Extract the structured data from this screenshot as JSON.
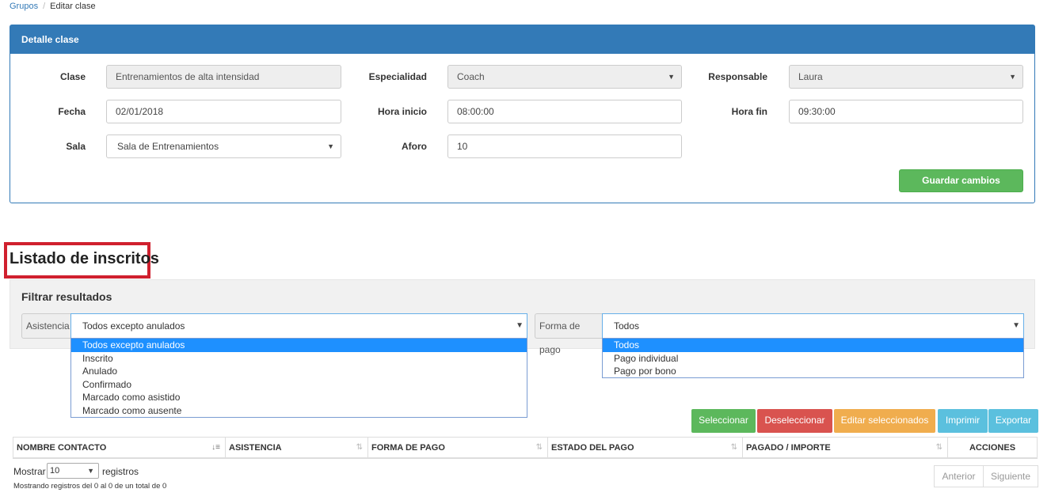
{
  "breadcrumb": {
    "link": "Grupos",
    "separator": "/",
    "current": "Editar clase"
  },
  "panel": {
    "heading": "Detalle clase",
    "clase": {
      "label": "Clase",
      "value": "Entrenamientos de alta intensidad"
    },
    "especialidad": {
      "label": "Especialidad",
      "value": "Coach"
    },
    "responsable": {
      "label": "Responsable",
      "value": "Laura"
    },
    "fecha": {
      "label": "Fecha",
      "value": "02/01/2018"
    },
    "hora_inicio": {
      "label": "Hora inicio",
      "value": "08:00:00"
    },
    "hora_fin": {
      "label": "Hora fin",
      "value": "09:30:00"
    },
    "sala": {
      "label": "Sala",
      "value": "Sala de Entrenamientos"
    },
    "aforo": {
      "label": "Aforo",
      "value": "10"
    },
    "save_button": "Guardar cambios"
  },
  "listado": {
    "title": "Listado de inscritos",
    "filter_title": "Filtrar resultados",
    "asistencia": {
      "label": "Asistencia",
      "selected": "Todos excepto anulados",
      "options": [
        "Todos excepto anulados",
        "Inscrito",
        "Anulado",
        "Confirmado",
        "Marcado como asistido",
        "Marcado como ausente"
      ]
    },
    "forma_pago": {
      "label": "Forma de pago",
      "selected": "Todos",
      "options": [
        "Todos",
        "Pago individual",
        "Pago por bono"
      ]
    }
  },
  "toolbar": {
    "seleccionar": "Seleccionar",
    "deseleccionar": "Deseleccionar",
    "editar": "Editar seleccionados",
    "imprimir": "Imprimir",
    "exportar": "Exportar"
  },
  "table": {
    "columns": [
      "NOMBRE CONTACTO",
      "ASISTENCIA",
      "FORMA DE PAGO",
      "ESTADO DEL PAGO",
      "PAGADO / IMPORTE",
      "ACCIONES"
    ]
  },
  "footer": {
    "mostrar": "Mostrar",
    "page_length": "10",
    "registros": "registros",
    "info": "Mostrando registros del 0 al 0 de un total de 0",
    "anterior": "Anterior",
    "siguiente": "Siguiente"
  },
  "colors": {
    "primary": "#337ab7",
    "success": "#5cb85c",
    "danger": "#d9534f",
    "warning": "#f0ad4e",
    "info": "#5bc0de",
    "highlight": "#d0202e"
  }
}
